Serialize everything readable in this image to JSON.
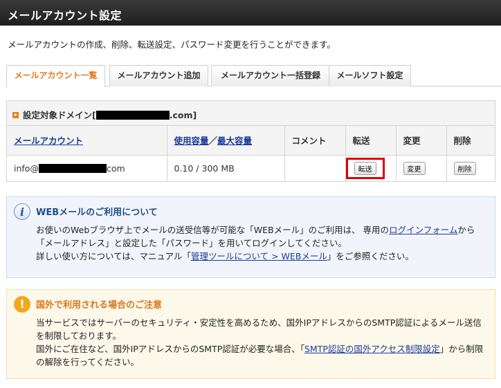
{
  "header": {
    "title": "メールアカウント設定"
  },
  "description": "メールアカウントの作成、削除、転送設定、パスワード変更を行うことができます。",
  "tabs": [
    {
      "label": "メールアカウント一覧",
      "active": true
    },
    {
      "label": "メールアカウント追加",
      "active": false
    },
    {
      "label": "メールアカウント一括登録",
      "active": false
    },
    {
      "label": "メールソフト設定",
      "active": false
    }
  ],
  "domain": {
    "prefix": "設定対象ドメイン[",
    "suffix": ".com]"
  },
  "table": {
    "headers": {
      "account": "メールアカウント",
      "usage": "使用容量",
      "separator": "／",
      "max": "最大容量",
      "comment": "コメント",
      "forward": "転送",
      "change": "変更",
      "delete": "削除"
    },
    "rows": [
      {
        "account_prefix": "info@",
        "account_suffix": "com",
        "usage": "0.10 / 300 MB",
        "comment": "",
        "forward_button": "転送",
        "change_button": "変更",
        "delete_button": "削除"
      }
    ]
  },
  "info": {
    "title": "WEBメールのご利用について",
    "icon": "info-icon",
    "p1_before": "お使いのWebブラウザ上でメールの送受信等が可能な「WEBメール」のご利用は、 専用の",
    "p1_link": "ログインフォーム",
    "p1_after": "から「メールアドレス」と設定した「パスワード」を用いてログインしてください。",
    "p2_before": "詳しい使い方については、マニュアル「",
    "p2_link": "管理ツールについて > WEBメール",
    "p2_after": "」をご参照ください。"
  },
  "warning": {
    "title": "国外で利用される場合のご注意",
    "icon": "exclamation-icon",
    "p1": "当サービスではサーバーのセキュリティ・安定性を高めるため、国外IPアドレスからのSMTP認証によるメール送信を制限しております。",
    "p2_before": "国外にご在住など、国外IPアドレスからのSMTP認証が必要な場合、「",
    "p2_link": "SMTP認証の国外アクセス制限設定",
    "p2_after": "」から制限の解除を行ってください。"
  },
  "colors": {
    "accent": "#e8761c",
    "link": "#1a3a9c",
    "highlight": "#e00000"
  }
}
